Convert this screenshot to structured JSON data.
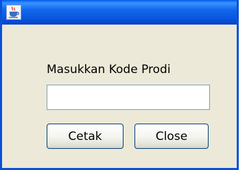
{
  "window": {
    "icon": "java-coffee-cup-icon",
    "title": ""
  },
  "form": {
    "prompt_label": "Masukkan Kode Prodi",
    "code_input_value": "",
    "code_input_placeholder": ""
  },
  "buttons": {
    "cetak_label": "Cetak",
    "close_label": "Close"
  },
  "colors": {
    "titlebar": "#0a56e0",
    "window_border": "#0a50d8",
    "panel_background": "#ece9d8",
    "button_border": "#003c74",
    "input_border": "#7f9db9"
  }
}
